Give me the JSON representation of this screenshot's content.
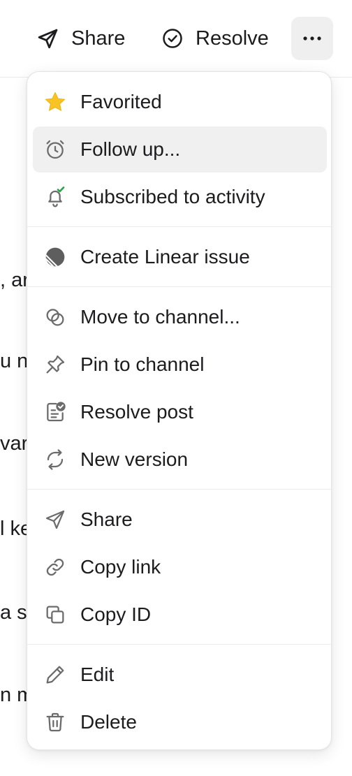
{
  "toolbar": {
    "share_label": "Share",
    "resolve_label": "Resolve",
    "more_icon": "ellipsis-icon"
  },
  "background_text": [
    ", ar",
    "u n",
    "var",
    "l ke",
    "a s",
    "n m"
  ],
  "menu": {
    "items": [
      {
        "label": "Favorited",
        "icon": "star-icon"
      },
      {
        "label": "Follow up...",
        "icon": "alarm-clock-icon"
      },
      {
        "label": "Subscribed to activity",
        "icon": "bell-check-icon"
      },
      {
        "label": "Create Linear issue",
        "icon": "linear-logo-icon"
      },
      {
        "label": "Move to channel...",
        "icon": "move-channel-icon"
      },
      {
        "label": "Pin to channel",
        "icon": "pin-icon"
      },
      {
        "label": "Resolve post",
        "icon": "resolve-post-icon"
      },
      {
        "label": "New version",
        "icon": "refresh-icon"
      },
      {
        "label": "Share",
        "icon": "send-icon"
      },
      {
        "label": "Copy link",
        "icon": "link-icon"
      },
      {
        "label": "Copy ID",
        "icon": "copy-icon"
      },
      {
        "label": "Edit",
        "icon": "pencil-icon"
      },
      {
        "label": "Delete",
        "icon": "trash-icon"
      }
    ]
  },
  "colors": {
    "star": "#F7C325",
    "check_accent": "#2DA44E",
    "icon_gray": "#6b6b6b",
    "hover_bg": "#f0f0f0",
    "divider": "#ebebeb"
  }
}
